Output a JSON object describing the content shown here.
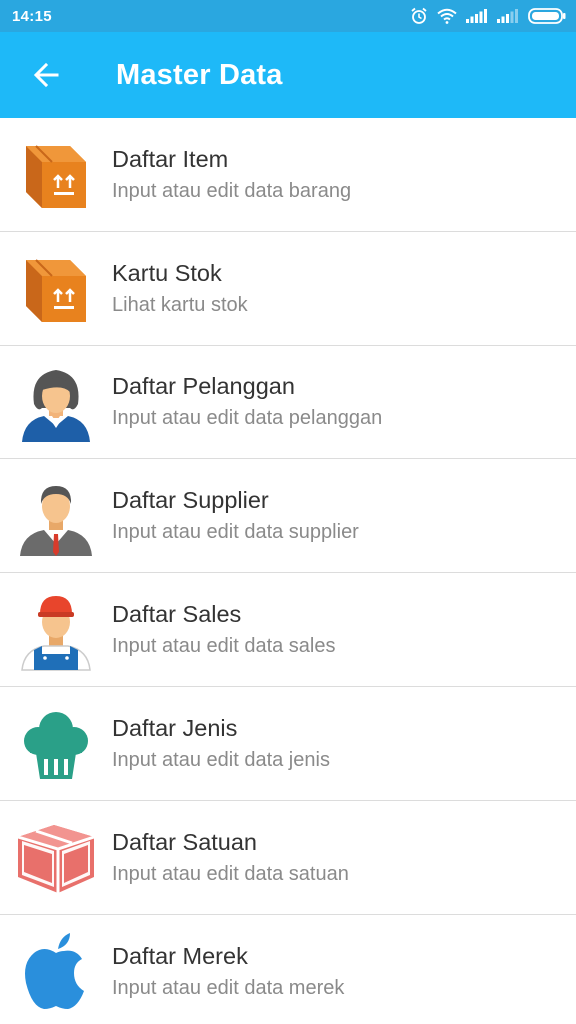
{
  "status_bar": {
    "time": "14:15",
    "icons": [
      "alarm-icon",
      "wifi-icon",
      "signal-icon",
      "signal-icon",
      "battery-icon"
    ]
  },
  "app_bar": {
    "title": "Master Data",
    "back_icon": "arrow-left-icon",
    "color": "#1eb9f8"
  },
  "menu": {
    "items": [
      {
        "title": "Daftar Item",
        "subtitle": "Input atau edit data barang",
        "icon": "box-icon"
      },
      {
        "title": "Kartu Stok",
        "subtitle": "Lihat kartu stok",
        "icon": "box-icon"
      },
      {
        "title": "Daftar Pelanggan",
        "subtitle": "Input atau edit data pelanggan",
        "icon": "customer-avatar-icon"
      },
      {
        "title": "Daftar Supplier",
        "subtitle": "Input atau edit data supplier",
        "icon": "supplier-avatar-icon"
      },
      {
        "title": "Daftar Sales",
        "subtitle": "Input atau edit data sales",
        "icon": "sales-avatar-icon"
      },
      {
        "title": "Daftar Jenis",
        "subtitle": "Input atau edit data jenis",
        "icon": "cupcake-icon"
      },
      {
        "title": "Daftar Satuan",
        "subtitle": "Input atau edit data satuan",
        "icon": "package-icon"
      },
      {
        "title": "Daftar Merek",
        "subtitle": "Input atau edit data merek",
        "icon": "apple-icon"
      }
    ]
  }
}
